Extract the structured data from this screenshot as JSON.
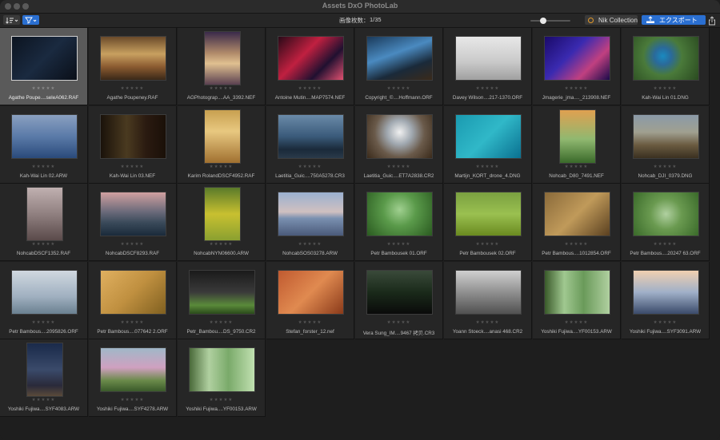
{
  "window": {
    "title": "Assets DxO PhotoLab"
  },
  "toolbar": {
    "sort_icon": "sort-icon",
    "filter_icon": "filter-icon",
    "count_label": "画像枚数：",
    "count_value": "1/35",
    "nik_label": "Nik Collection",
    "export_label": "エクスポート",
    "share_icon": "share-icon"
  },
  "colors": {
    "accent": "#2a6fd1",
    "nik_ring": "#e39a2b",
    "selection": "#5a5a5a"
  },
  "images": [
    {
      "name": "Agathe Poupe....seleA062.RAF",
      "stars": "★★★★★",
      "bg": "linear-gradient(135deg,#0c1420,#1a2a40 50%,#0a0f18)",
      "portrait": false,
      "selected": true
    },
    {
      "name": "Agathe Poupeney.RAF",
      "stars": "★★★★★",
      "bg": "linear-gradient(180deg,#6a4a2a,#c8a060 40%,#8a5a30 70%,#3a2818)",
      "portrait": false
    },
    {
      "name": "AGPhotograp....AA_3392.NEF",
      "stars": "★★★★★",
      "bg": "linear-gradient(180deg,#3a2a4a,#b08a6a 40%,#e0c090 60%,#5a4050)",
      "portrait": true
    },
    {
      "name": "Antoine Mutin....MAP7574.NEF",
      "stars": "★★★★★",
      "bg": "linear-gradient(135deg,#2a0a18,#c02040 40%,#201030 70%,#e05070)",
      "portrait": false
    },
    {
      "name": "Copyright_©....Hoffmann.ORF",
      "stars": "★★★★★",
      "bg": "linear-gradient(160deg,#1a3a5a,#4a8ac0 40%,#1a2a3a 70%,#3a2a1a)",
      "portrait": false
    },
    {
      "name": "Davey Wilson....217-1370.ORF",
      "stars": "★★★★★",
      "bg": "linear-gradient(180deg,#e8e8e8,#c8c8c8 60%,#a0a0a0)",
      "portrait": false
    },
    {
      "name": "Jmagerie_jma...._213908.NEF",
      "stars": "★★★★★",
      "bg": "linear-gradient(135deg,#1a0a6a,#3a2ab0 40%,#c04080 70%,#1a0a4a)",
      "portrait": false
    },
    {
      "name": "Kah-Wai Lin 01.DNG",
      "stars": "★★★★★",
      "bg": "radial-gradient(circle at 45% 45%,#1a8ac0 0,#2a6a9a 20%,#4a7a3a 45%,#2a4a20 100%)",
      "portrait": false
    },
    {
      "name": "Kah-Wai Lin 02.ARW",
      "stars": "★★★★★",
      "bg": "linear-gradient(180deg,#8aa0c0,#5a7aa8 50%,#2a4a7a)",
      "portrait": false
    },
    {
      "name": "Kah-Wai Lin 03.NEF",
      "stars": "★★★★★",
      "bg": "linear-gradient(90deg,#1a120a,#4a3a20 40%,#2a1a10 70%,#1a1008)",
      "portrait": false
    },
    {
      "name": "Karim RolandDSCF4952.RAF",
      "stars": "★★★★★",
      "bg": "linear-gradient(180deg,#c8a050,#e8c880 40%,#a07030)",
      "portrait": true
    },
    {
      "name": "Laetitia_Guic....750A5278.CR3",
      "stars": "★★★★★",
      "bg": "linear-gradient(180deg,#6a8aa8,#3a5a7a 50%,#1a2a3a 80%,#2a3a4a)",
      "portrait": false
    },
    {
      "name": "Laetitia_Guic....ET7A2838.CR2",
      "stars": "★★★★★",
      "bg": "radial-gradient(circle at 50% 40%,#f0f0f0 0,#a0a8b0 30%,#6a5a4a 60%,#3a2a1a 100%)",
      "portrait": false
    },
    {
      "name": "Martijn_KORT_drone_4.DNG",
      "stars": "★★★★★",
      "bg": "linear-gradient(135deg,#1a9ab0,#30b8c8 50%,#0a7090)",
      "portrait": false
    },
    {
      "name": "Nohcab_D80_7491.NEF",
      "stars": "★★★★★",
      "bg": "linear-gradient(180deg,#e0a050,#90b870 55%,#3a6a2a)",
      "portrait": true
    },
    {
      "name": "Nohcab_DJI_0379.DNG",
      "stars": "★★★★★",
      "bg": "linear-gradient(180deg,#8a9aa8,#a0a090 40%,#6a5a40 70%,#3a3020)",
      "portrait": false
    },
    {
      "name": "NohcabDSCF1352.RAF",
      "stars": "★★★★★",
      "bg": "linear-gradient(180deg,#c0b0b0,#908080 50%,#5a4a4a)",
      "portrait": true
    },
    {
      "name": "NohcabDSCF8293.RAF",
      "stars": "★★★★★",
      "bg": "linear-gradient(180deg,#d0a0a0,#6a6a7a 45%,#3a4a5a 70%,#1a2a3a)",
      "portrait": false
    },
    {
      "name": "NohcabNYN06600.ARW",
      "stars": "★★★★★",
      "bg": "linear-gradient(180deg,#5a7a2a,#c8c030 50%,#8aa030)",
      "portrait": true
    },
    {
      "name": "NohcabSOS03278.ARW",
      "stars": "★★★★★",
      "bg": "linear-gradient(180deg,#9ab0d0,#d0c0c0 45%,#7a90b0 60%,#4a5a7a)",
      "portrait": false
    },
    {
      "name": "Petr Bambousek 01.ORF",
      "stars": "★★★★★",
      "bg": "radial-gradient(circle at 50% 40%,#a0d090 0,#5a9a4a 40%,#2a5a20 100%)",
      "portrait": false
    },
    {
      "name": "Petr Bambousek 02.ORF",
      "stars": "★★★★★",
      "bg": "linear-gradient(180deg,#7aa040,#9ac050 50%,#6a8a20)",
      "portrait": false
    },
    {
      "name": "Petr Bambous....1012854.ORF",
      "stars": "★★★★★",
      "bg": "linear-gradient(135deg,#8a6a3a,#c09a5a 50%,#5a4020)",
      "portrait": false
    },
    {
      "name": "Petr Bambous....20247 63.ORF",
      "stars": "★★★★★",
      "bg": "radial-gradient(circle at 50% 50%,#b0d0a0 0,#6a9a50 40%,#3a6a2a 100%)",
      "portrait": false
    },
    {
      "name": "Petr Bambous....2095826.ORF",
      "stars": "★★★★★",
      "bg": "linear-gradient(180deg,#d0d8e0,#a0b0c0 60%,#6a8090)",
      "portrait": false
    },
    {
      "name": "Petr Bambous....077642 2.ORF",
      "stars": "★★★★★",
      "bg": "linear-gradient(135deg,#e0b060,#c09040 50%,#806020)",
      "portrait": false
    },
    {
      "name": "Petr_Bambou....DS_9750.CR2",
      "stars": "★★★★★",
      "bg": "linear-gradient(180deg,#1a1a1a,#3a3a3a 50%,#5a8a3a 80%,#2a4a1a)",
      "portrait": false
    },
    {
      "name": "Stefan_forster_12.nef",
      "stars": "★★★★★",
      "bg": "linear-gradient(135deg,#c05a30,#e08a50 50%,#8a3a1a)",
      "portrait": false
    },
    {
      "name": "Vera Sung_IM....9467 拷贝.CR3",
      "stars": "★★★★★",
      "bg": "linear-gradient(180deg,#3a4a3a,#1a2a1a 50%,#0a0a0a)",
      "portrait": false
    },
    {
      "name": "Yoann Stoeck....anasi 468.CR2",
      "stars": "★★★★★",
      "bg": "linear-gradient(180deg,#d0d0d0,#909090 50%,#505050)",
      "portrait": false
    },
    {
      "name": "Yoshiki Fujiwa....YF00153.ARW",
      "stars": "★★★★★",
      "bg": "linear-gradient(90deg,#3a5a2a,#a0c890 30%,#6a9a5a 60%,#b0d0a0)",
      "portrait": false
    },
    {
      "name": "Yoshiki Fujiwa....SYF3091.ARW",
      "stars": "★★★★★",
      "bg": "linear-gradient(180deg,#f0d0b0,#a0b0c8 50%,#3a4a6a)",
      "portrait": false
    },
    {
      "name": "Yoshiki Fujiwa....SYF4083.ARW",
      "stars": "★★★★★",
      "bg": "linear-gradient(180deg,#1a2a4a,#3a4a6a 50%,#2a2a3a 80%,#5a4a3a)",
      "portrait": true
    },
    {
      "name": "Yoshiki Fujiwa....SYF4278.ARW",
      "stars": "★★★★★",
      "bg": "linear-gradient(180deg,#a0b8c8,#d0a0c0 45%,#6a8a4a 75%,#3a5a2a)",
      "portrait": false
    },
    {
      "name": "Yoshiki Fujiwa....YF00153.ARW",
      "stars": "★★★★★",
      "bg": "linear-gradient(90deg,#4a6a3a,#b0d0a0 30%,#7aaa6a 60%,#c0e0b0)",
      "portrait": false
    }
  ]
}
